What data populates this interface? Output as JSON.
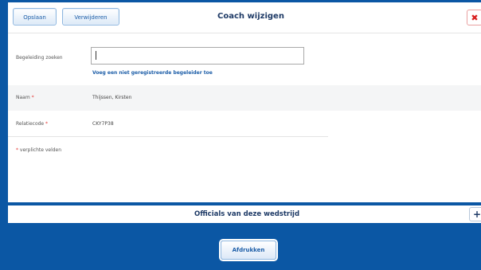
{
  "header": {
    "save_label": "Opslaan",
    "delete_label": "Verwijderen",
    "title": "Coach wijzigen",
    "close_glyph": "✖"
  },
  "form": {
    "search_label": "Begeleiding zoeken",
    "search_value": "",
    "add_unregistered_link": "Voeg een niet geregistreerde begeleider toe",
    "name_label": "Naam",
    "name_value": "Thijssen, Kirsten",
    "relation_label": "Relatiecode",
    "relation_value": "CKY7P38",
    "required_marker": "*",
    "required_note": "verplichte velden"
  },
  "officials": {
    "title": "Officials van deze wedstrijd",
    "add_glyph": "+"
  },
  "footer": {
    "print_label": "Afdrukken"
  },
  "colors": {
    "frame_blue": "#0b57a4",
    "required_red": "#e53935",
    "link_blue": "#1d5ea8"
  }
}
